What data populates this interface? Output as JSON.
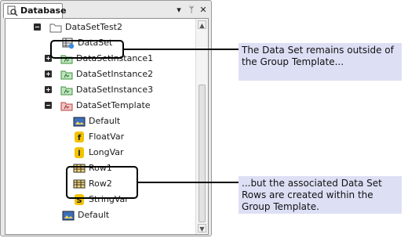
{
  "panel": {
    "title": "Database",
    "tab_icon": "database-search-icon",
    "buttons": [
      {
        "name": "dropdown-icon",
        "glyph": "▾"
      },
      {
        "name": "pin-icon",
        "glyph": "ᛘ"
      },
      {
        "name": "close-icon",
        "glyph": "✕"
      }
    ]
  },
  "tree": {
    "items": [
      {
        "label": "DataSetTest2",
        "icon": "folder-icon",
        "expander": "minus"
      },
      {
        "label": "DataSet",
        "icon": "dataset-table-icon",
        "expander": ""
      },
      {
        "label": "DataSetInstance1",
        "icon": "dataset-instance-icon",
        "expander": "plus"
      },
      {
        "label": "DataSetInstance2",
        "icon": "dataset-instance-icon",
        "expander": "plus"
      },
      {
        "label": "DataSetInstance3",
        "icon": "dataset-instance-icon",
        "expander": "plus"
      },
      {
        "label": "DataSetTemplate",
        "icon": "dataset-template-icon",
        "expander": "minus"
      },
      {
        "label": "Default",
        "icon": "default-image-icon",
        "expander": ""
      },
      {
        "label": "FloatVar",
        "icon": "float-variable-icon",
        "expander": "",
        "glyph": "f"
      },
      {
        "label": "LongVar",
        "icon": "long-variable-icon",
        "expander": "",
        "glyph": "l"
      },
      {
        "label": "Row1",
        "icon": "dataset-row-icon",
        "expander": ""
      },
      {
        "label": "Row2",
        "icon": "dataset-row-icon",
        "expander": ""
      },
      {
        "label": "StringVar",
        "icon": "string-variable-icon",
        "expander": "",
        "glyph": "S"
      },
      {
        "label": "Default",
        "icon": "default-image-icon",
        "expander": ""
      }
    ]
  },
  "callouts": [
    {
      "text": "The Data Set remains outside of the Group Template..."
    },
    {
      "text": "...but the associated Data Set Rows are created within the Group Template."
    }
  ],
  "colors": {
    "callout_bg": "#dddff5",
    "variable_badge": "#f2c300",
    "folder_green": "#7fc77f",
    "template_red": "#d65a5a"
  }
}
